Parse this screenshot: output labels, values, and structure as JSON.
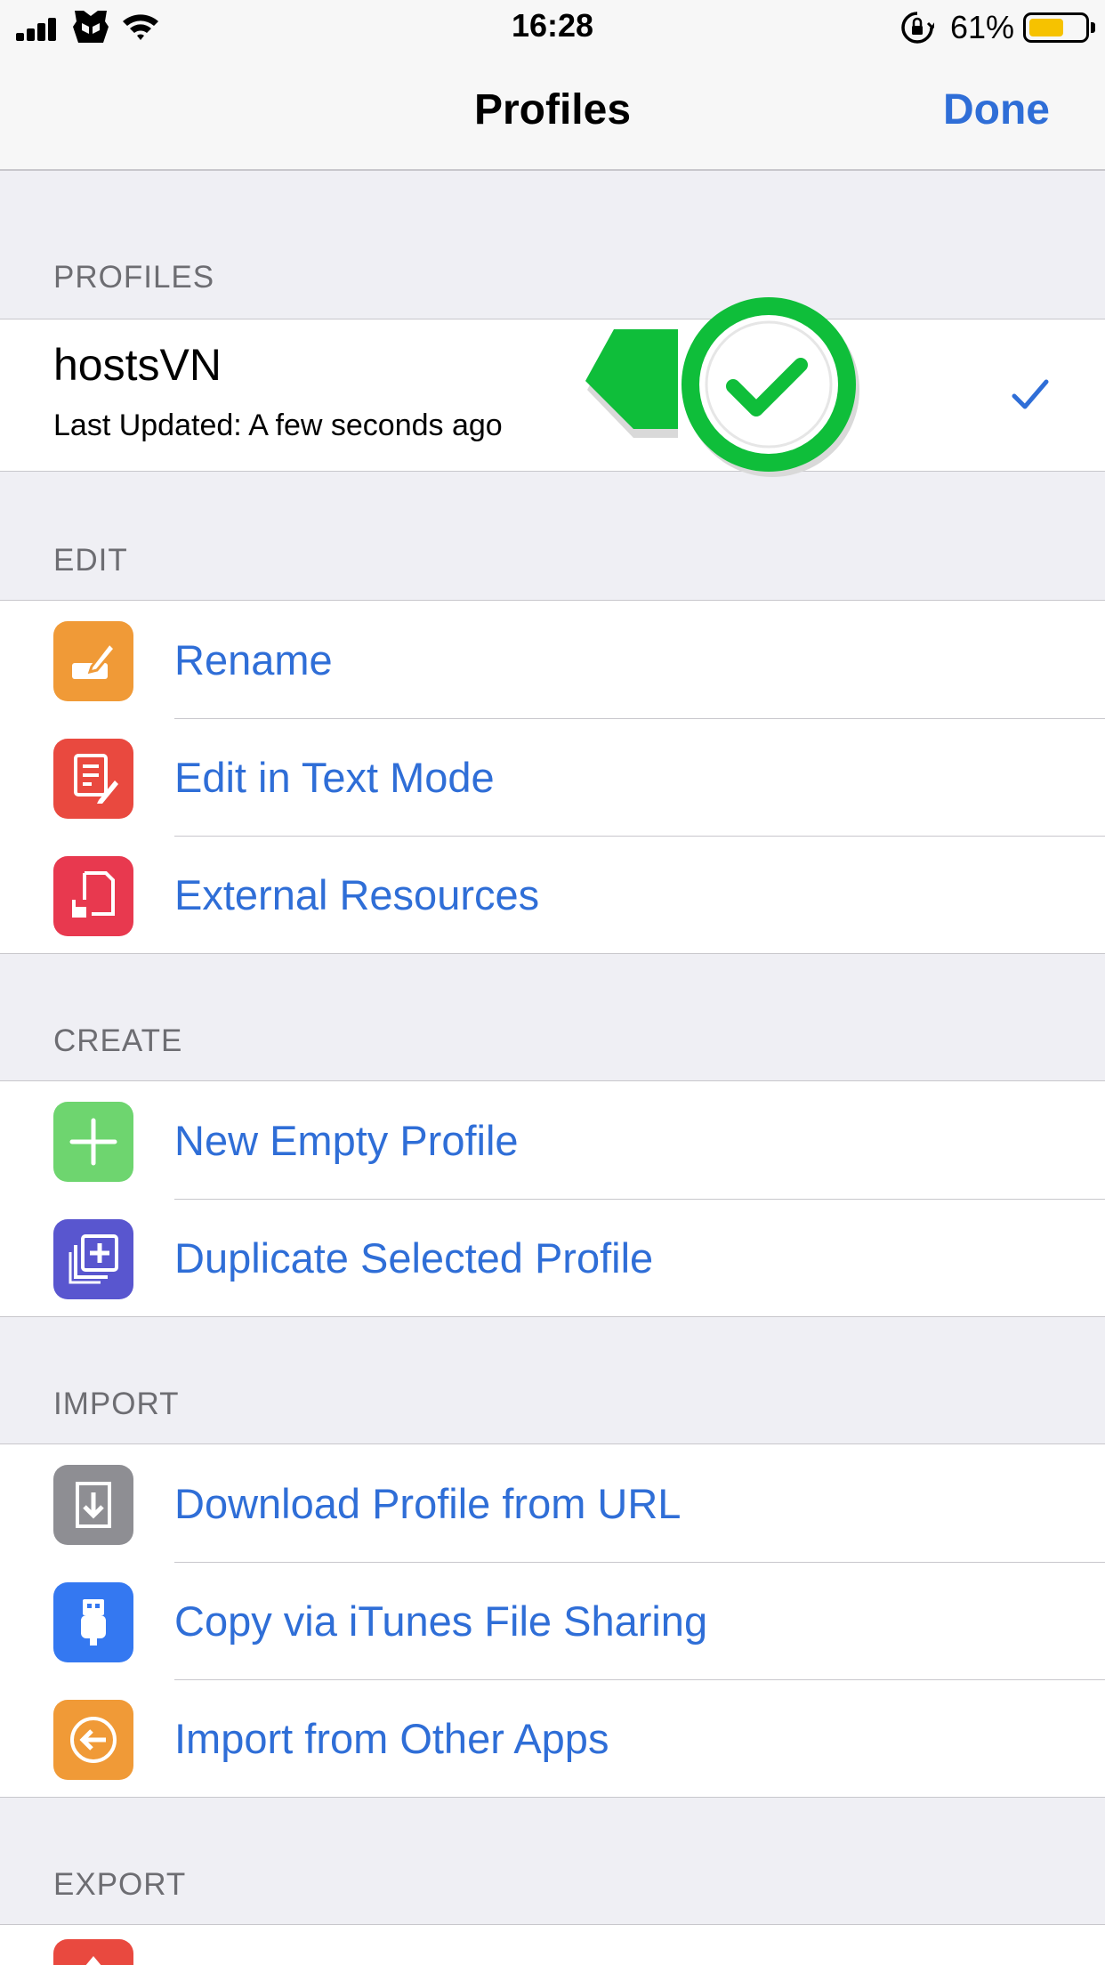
{
  "status": {
    "time": "16:28",
    "battery": "61%",
    "battery_level": 0.61
  },
  "nav": {
    "title": "Profiles",
    "done": "Done"
  },
  "sections": {
    "profiles": "PROFILES",
    "edit": "EDIT",
    "create": "CREATE",
    "import": "IMPORT",
    "export": "EXPORT"
  },
  "profile": {
    "name": "hostsVN",
    "updated": "Last Updated: A few seconds ago",
    "selected": true
  },
  "edit": [
    {
      "label": "Rename",
      "icon": "pencil-icon",
      "color": "#f09a37"
    },
    {
      "label": "Edit in Text Mode",
      "icon": "document-edit-icon",
      "color": "#e9493f"
    },
    {
      "label": "External Resources",
      "icon": "external-resource-icon",
      "color": "#e8394f"
    }
  ],
  "create": [
    {
      "label": "New Empty Profile",
      "icon": "plus-icon",
      "color": "#6ed56f"
    },
    {
      "label": "Duplicate Selected Profile",
      "icon": "duplicate-icon",
      "color": "#5956cf"
    }
  ],
  "import": [
    {
      "label": "Download Profile from URL",
      "icon": "download-icon",
      "color": "#8e8e93"
    },
    {
      "label": "Copy via iTunes File Sharing",
      "icon": "usb-icon",
      "color": "#3478f1"
    },
    {
      "label": "Import from Other Apps",
      "icon": "import-icon",
      "color": "#f09a37"
    }
  ],
  "accent": "#2f6ed7"
}
